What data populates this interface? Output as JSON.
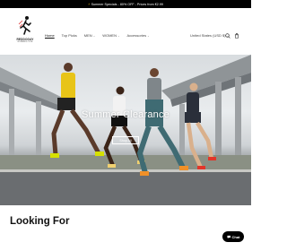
{
  "announcement": {
    "bolt": "⚡",
    "text": "Summer Specials - 80% OFF - Prices from €2.99"
  },
  "brand": {
    "name": "REDDOGAY",
    "tagline": "RUNNING CLUB"
  },
  "nav": {
    "items": [
      {
        "label": "Home",
        "active": true,
        "has_dropdown": false
      },
      {
        "label": "Top Picks",
        "active": false,
        "has_dropdown": false
      },
      {
        "label": "MEN",
        "active": false,
        "has_dropdown": true
      },
      {
        "label": "WOMEN",
        "active": false,
        "has_dropdown": true
      },
      {
        "label": "Accessories",
        "active": false,
        "has_dropdown": true
      }
    ],
    "chevron": "⌄"
  },
  "locale": {
    "label": "United States (USD $)",
    "chevron": "⌄"
  },
  "icons": {
    "search": "search-icon",
    "cart": "cart-icon",
    "chat": "chat-icon"
  },
  "hero": {
    "title": "Summer Clearance",
    "button_label": "Shop All"
  },
  "section": {
    "title": "Looking For"
  },
  "chat": {
    "label": "Chat"
  },
  "colors": {
    "announcement_bg": "#000000",
    "accent": "#f5c518",
    "chat_bg": "#000000"
  }
}
